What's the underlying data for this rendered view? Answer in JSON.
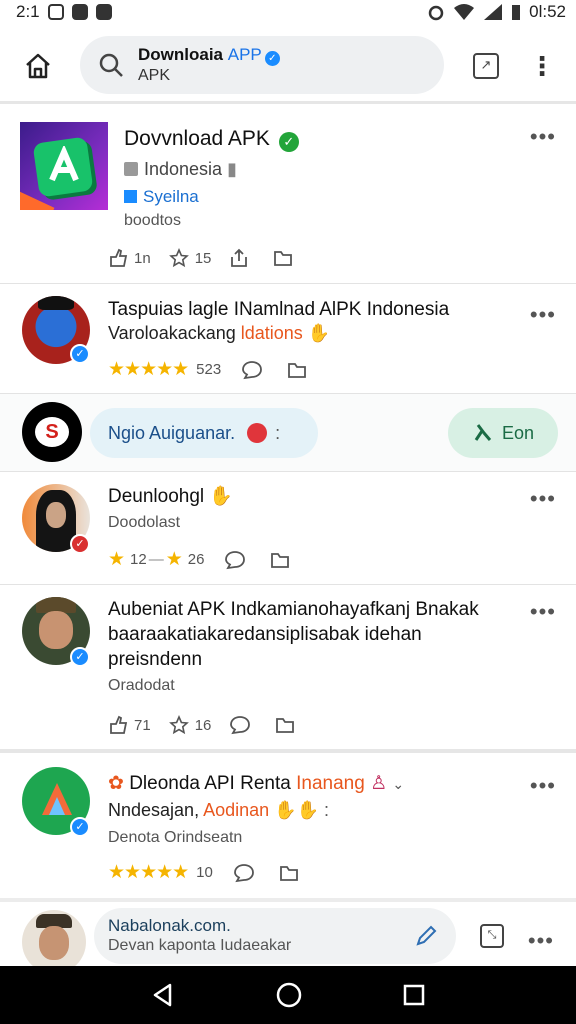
{
  "status_bar": {
    "time": "2:1",
    "battery": "0l:52"
  },
  "top_bar": {
    "search_title": "Downloaia",
    "search_title_accent": "APP",
    "search_subtitle": "APK"
  },
  "posts": [
    {
      "title": "Dovvnload APK",
      "line1": "Indonesia",
      "line2": "Syeilna",
      "line3": "boodtos",
      "actions": {
        "likes": "1n",
        "stars": "15"
      }
    },
    {
      "title": "Taspuias lagle INamlnad AlPK Indonesia",
      "line1": "Varoloakackang",
      "line1_accent": "ldations",
      "rating_count": "523"
    },
    {
      "title": "Deunloohgl",
      "line1": "Doodolast",
      "count_a": "12",
      "count_b": "26"
    },
    {
      "title_lines": [
        "Aubeniat APK Indkamianohayafkanj Bnakak",
        "baaraakatiakaredansiplisabak idehan",
        "preisndenn"
      ],
      "line1": "Oradodat",
      "actions": {
        "likes": "71",
        "stars": "16"
      }
    },
    {
      "title": "Dleonda API Renta",
      "title_accent": "Inanang",
      "line1": "Nndesajan,",
      "line1_accent": "Aodinan",
      "line2": "Denota Orindseatn",
      "rating_count": "10"
    }
  ],
  "story_bar": {
    "story_label": "Ngio Auiguanar.",
    "follow_label": "Eon"
  },
  "composer": {
    "line1": "Nabalonak.com.",
    "line2": "Devan kaponta Iudaeakar"
  },
  "colors": {
    "accent_blue": "#1a73e8",
    "verified": "#1a8cff",
    "star": "#f5b400",
    "orange_text": "#e8571e",
    "follow_green": "#1b6b45"
  }
}
